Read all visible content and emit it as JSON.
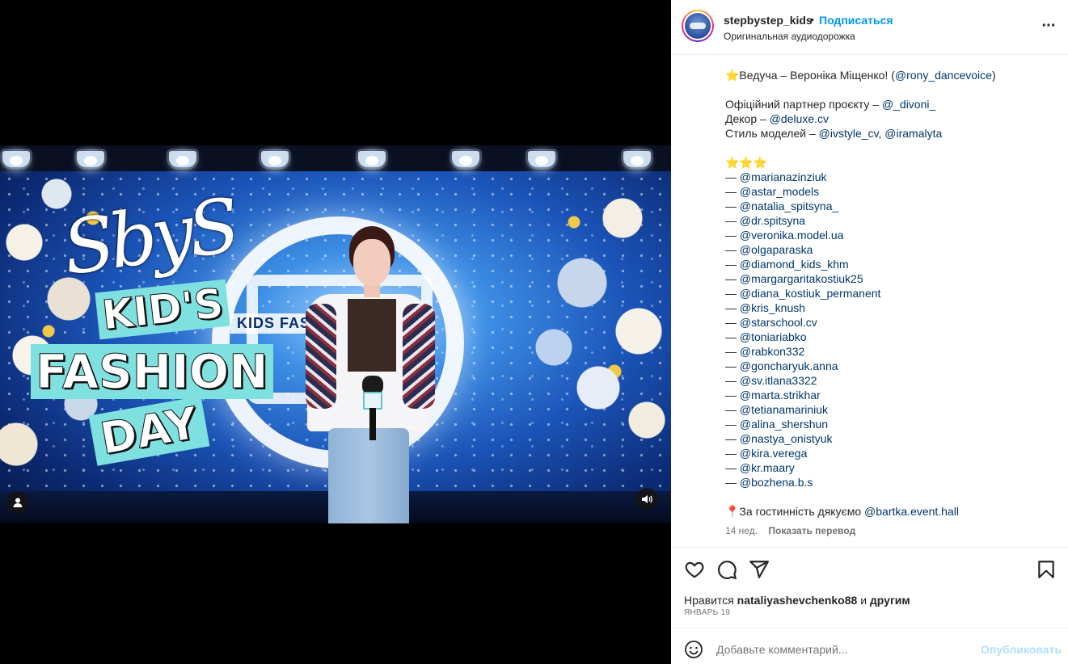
{
  "post": {
    "username": "stepbystep_kids",
    "separator": "•",
    "follow_label": "Подписаться",
    "audio_label": "Оригинальная аудиодорожка",
    "more_label": "···"
  },
  "media": {
    "brand_script": "SbyS",
    "brand_kids": "KID'S",
    "brand_fashion": "FASHION",
    "brand_day": "DAY",
    "screen_text": "KIDS FAS"
  },
  "caption": {
    "host_prefix": "⭐Ведуча – Вероніка Міщенко! (",
    "host_handle": "@rony_dancevoice",
    "host_suffix": ")",
    "partner_prefix": "Офіційний партнер проєкту – ",
    "partner_handle": "@_divoni_",
    "decor_prefix": "Декор – ",
    "decor_handle": "@deluxe.cv",
    "style_prefix": "Стиль моделей – ",
    "style_handle_1": "@ivstyle_cv",
    "style_sep": ", ",
    "style_handle_2": "@iramalyta",
    "stars": "⭐⭐⭐",
    "dash": "— ",
    "models": [
      "@marianazinziuk",
      "@astar_models",
      "@natalia_spitsyna_",
      "@dr.spitsyna",
      "@veronika.model.ua",
      "@olgaparaska",
      "@diamond_kids_khm",
      "@margargaritakostiuk25",
      "@diana_kostiuk_permanent",
      "@kris_knush",
      "@starschool.cv",
      "@toniariabko",
      "@rabkon332",
      "@goncharyuk.anna",
      "@sv.itlana3322",
      "@marta.strikhar",
      "@tetianamariniuk",
      "@alina_shershun",
      "@nastya_onistyuk",
      "@kira.verega",
      "@kr.maary",
      "@bozhena.b.s"
    ],
    "thanks_prefix": "📍За гостинність дякуємо ",
    "thanks_handle": "@bartka.event.hall"
  },
  "meta": {
    "age": "14 нед.",
    "translate_label": "Показать перевод"
  },
  "likes": {
    "prefix": "Нравится ",
    "user": "nataliyashevchenko88",
    "middle": " и ",
    "others": "другим"
  },
  "date": "ЯНВАРЬ 19",
  "comment": {
    "placeholder": "Добавьте комментарий...",
    "publish_label": "Опубликовать"
  },
  "icons": {
    "like": "heart-icon",
    "comment": "comment-icon",
    "share": "share-icon",
    "save": "bookmark-icon",
    "emoji": "emoji-icon",
    "user": "user-icon",
    "sound": "sound-icon"
  },
  "colors": {
    "link": "#00376b",
    "follow": "#0095f6",
    "publish_disabled": "#b2dffc",
    "brand_tag": "#7fe0e0"
  }
}
